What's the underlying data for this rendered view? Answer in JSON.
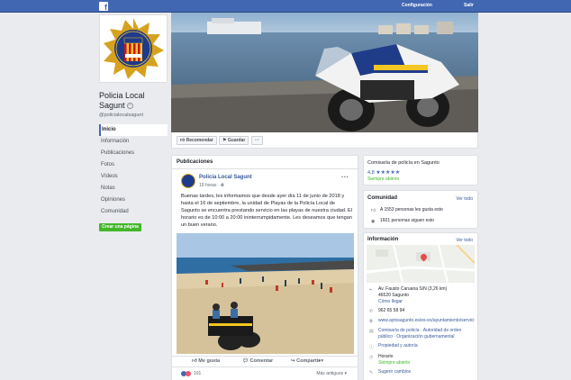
{
  "topbar": {
    "logo": "f",
    "settings": "Configuración",
    "logout": "Salir"
  },
  "page": {
    "name": "Policia Local Sagunt",
    "handle": "@policialocalsagunt",
    "badge_text": "Policia Local Sagunt",
    "badge_sub": "SAGUNT"
  },
  "nav": [
    "Inicio",
    "Información",
    "Publicaciones",
    "Fotos",
    "Vídeos",
    "Notas",
    "Opiniones",
    "Comunidad"
  ],
  "create_page": "Crear una página",
  "actions": {
    "recommend": "Recomendar",
    "save": "Guardar",
    "more": "···"
  },
  "posts": {
    "header": "Publicaciones",
    "author": "Policia Local Sagunt",
    "time": "19 horas · ",
    "menu": "···",
    "text": "Buenas tardes, les informamos que desde ayer día 11 de junio de 2018 y hasta el 16 de septiembre, la unidad de Playas de la Policía Local de Sagunto se encuentra prestando servicio en las playas de nuestra ciudad. El horario es de 10:00 a 20:00 ininterrumpidamente. Les deseamos que tengan un buen verano.",
    "like": "Me gusta",
    "comment": "Comentar",
    "share": "Compartir",
    "reaction_count": "101",
    "relevant": "Más antiguos ▾"
  },
  "about_card": {
    "category": "Comisaría de policía en Sagunto",
    "rating": "4,8",
    "stars": "★★★★★",
    "status": "Siempre abierto"
  },
  "community": {
    "title": "Comunidad",
    "see_all": "Ver todo",
    "likes": "A 1553 personas les gusta esto",
    "follows": "1601 personas siguen esto"
  },
  "info": {
    "title": "Información",
    "see_all": "Ver todo",
    "address_line1": "Av. Fausto Caruana S/N (3,26 km)",
    "address_line2": "46520 Sagunto",
    "directions": "Cómo llegar",
    "phone": "962 65 58 94",
    "website": "www.aytosagunto.es/es-es/ayuntamiento/servici",
    "categories": "Comisaría de policía · Autoridad de orden público · Organización gubernamental",
    "privacy": "Propiedad y autoría",
    "hours_label": "Horario",
    "hours_value": "Siempre abierto",
    "suggest": "Sugerir cambios"
  },
  "colors": {
    "fb_blue": "#4267b2",
    "link": "#385898",
    "green": "#42b72a",
    "bg": "#e9ebee"
  }
}
